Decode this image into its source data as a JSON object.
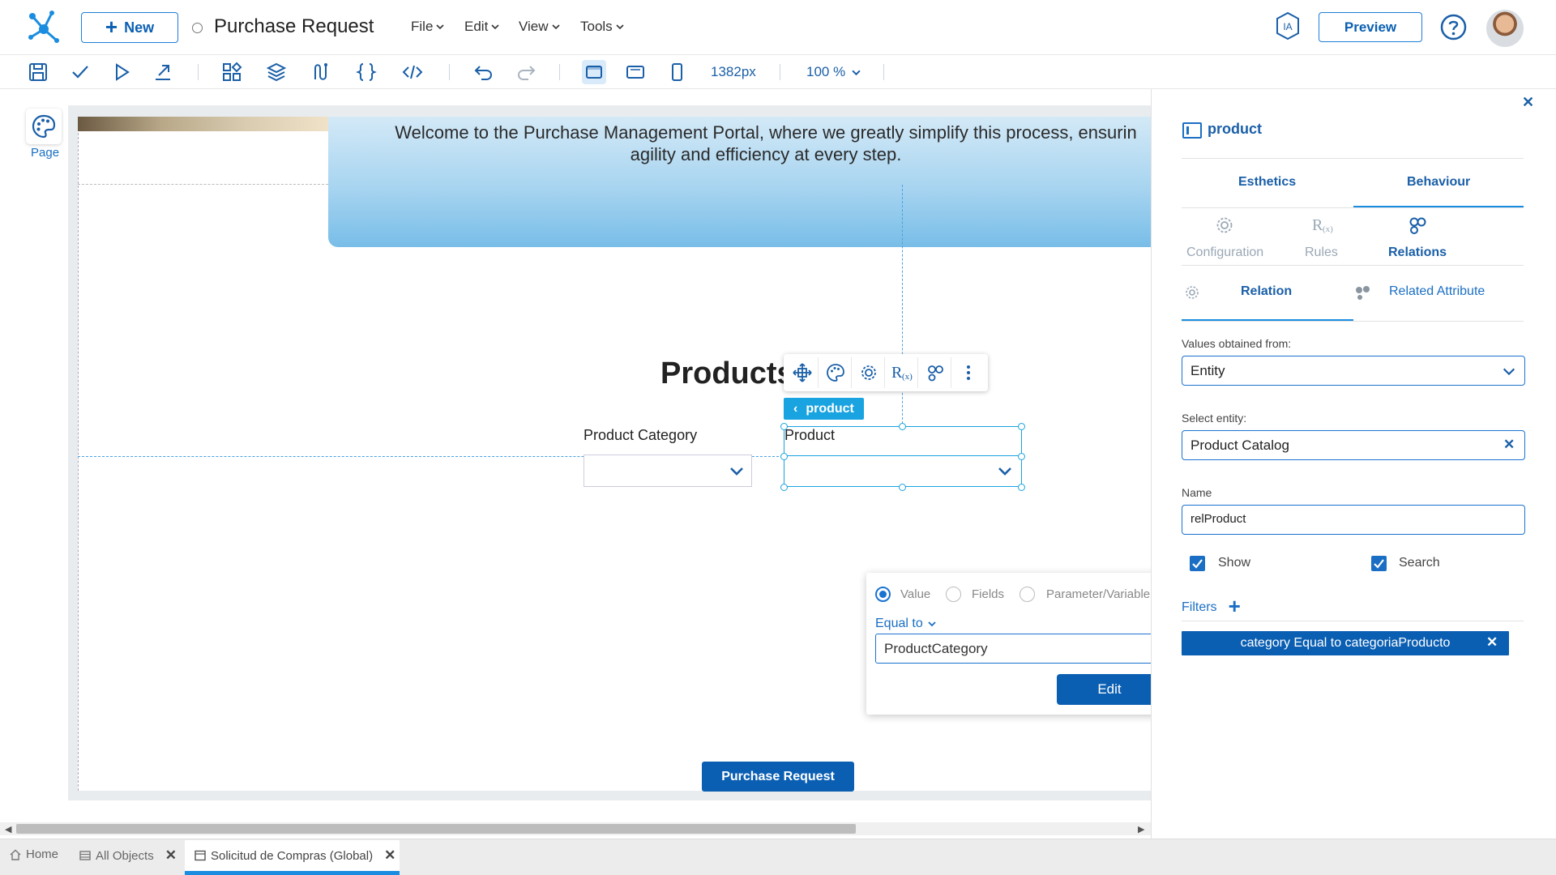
{
  "header": {
    "new_label": "New",
    "doc_title": "Purchase Request",
    "menus": [
      "File",
      "Edit",
      "View",
      "Tools"
    ],
    "ia_label": "IA",
    "preview_label": "Preview"
  },
  "toolbar": {
    "width_value": "1382px",
    "zoom_value": "100 %"
  },
  "left_panel": {
    "page_label": "Page"
  },
  "canvas": {
    "hero_text": "Welcome to the Purchase Management Portal, where we greatly simplify this process, ensurin agility and efficiency at every step.",
    "products_title": "Products",
    "selected_tag": "product",
    "category_label": "Product Category",
    "product_label": "Product",
    "purchase_button": "Purchase Request"
  },
  "filter_popup": {
    "radio_value": "Value",
    "radio_fields": "Fields",
    "radio_param": "Parameter/Variable",
    "operator": "Equal to",
    "value": "ProductCategory",
    "edit_label": "Edit"
  },
  "right_panel": {
    "title": "product",
    "tabs": {
      "esthetics": "Esthetics",
      "behaviour": "Behaviour"
    },
    "subtabs": {
      "configuration": "Configuration",
      "rules": "Rules",
      "relations": "Relations"
    },
    "relation_tabs": {
      "relation": "Relation",
      "related_attribute": "Related Attribute"
    },
    "values_from_label": "Values obtained from:",
    "values_from_value": "Entity",
    "select_entity_label": "Select entity:",
    "select_entity_value": "Product Catalog",
    "name_label": "Name",
    "name_value": "relProduct",
    "show_label": "Show",
    "search_label": "Search",
    "filters_label": "Filters",
    "filter_chip": "category Equal to categoriaProducto"
  },
  "bottom_tabs": {
    "home": "Home",
    "all_objects": "All Objects",
    "active_tab": "Solicitud de Compras (Global)"
  },
  "colors": {
    "accent": "#1a73d0",
    "primary_button": "#0b5fb3",
    "selection": "#19a3e0"
  }
}
